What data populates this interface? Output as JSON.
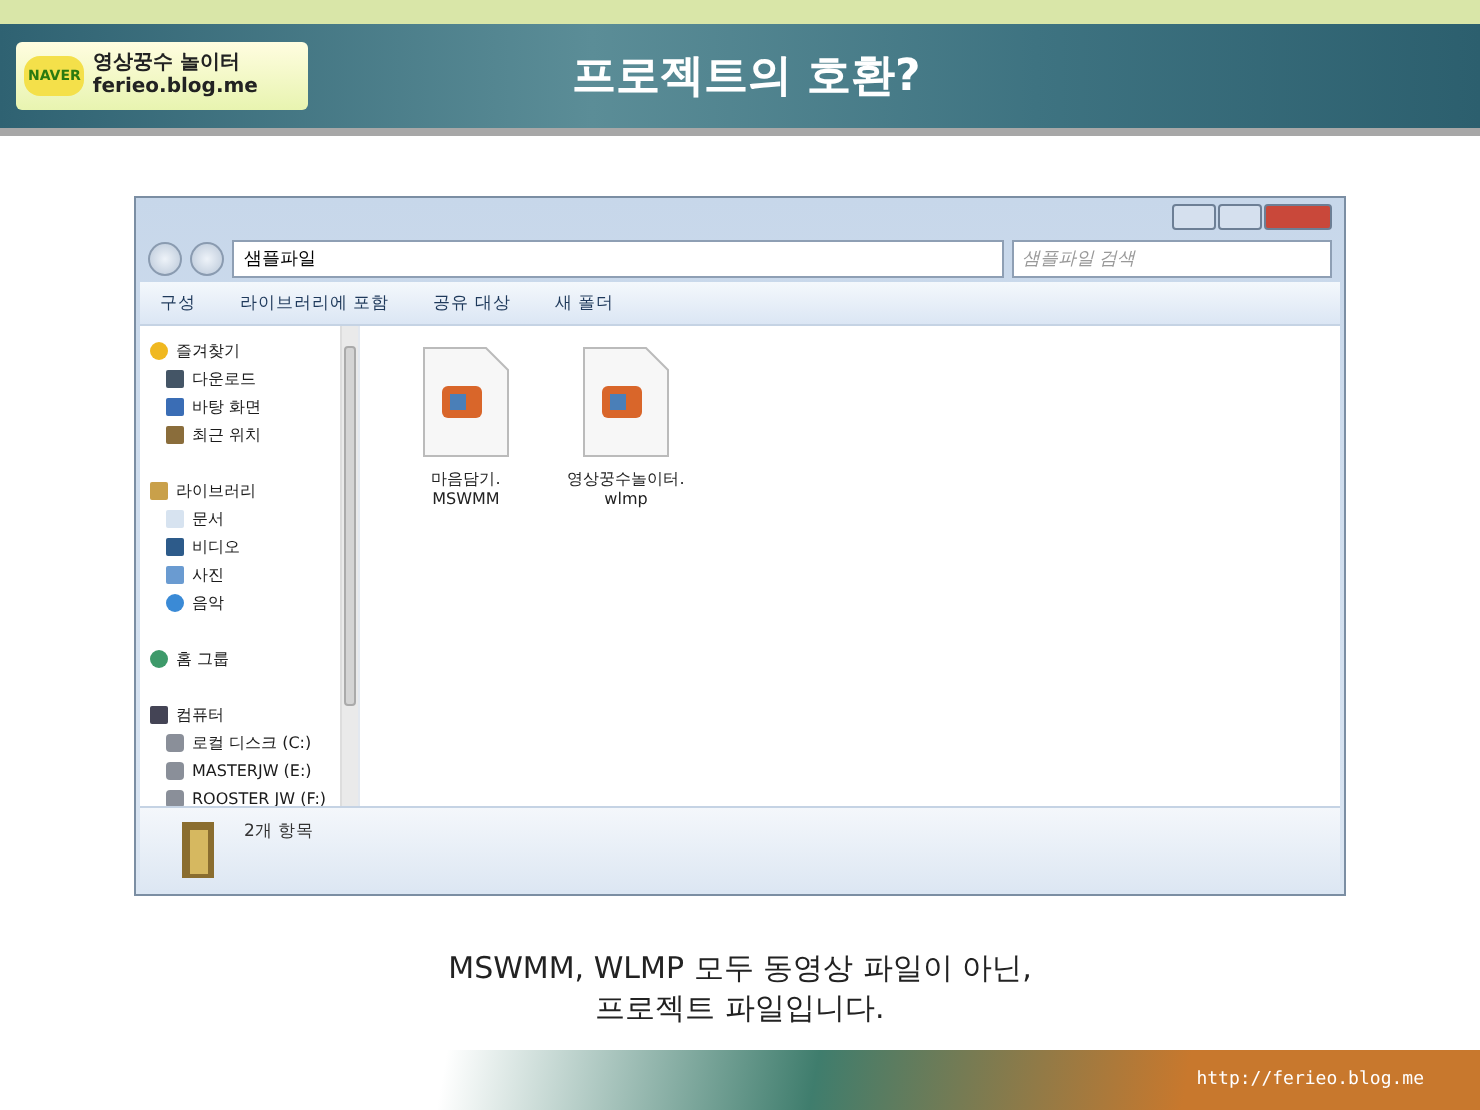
{
  "slide": {
    "logo": {
      "badge": "NAVER",
      "line_1": "영상꿍수 놀이터",
      "line_2": "ferieo.blog.me"
    },
    "title": "프로젝트의 호환?",
    "caption": [
      "MSWMM, WLMP 모두 동영상 파일이 아닌,",
      "프로젝트 파일입니다."
    ],
    "footer_url": "http://ferieo.blog.me"
  },
  "window": {
    "address": {
      "path": "샘플파일"
    },
    "search": {
      "placeholder": "샘플파일 검색"
    },
    "toolbar": [
      "구성",
      "라이브러리에 포함",
      "공유 대상",
      "새 폴더"
    ],
    "sidebar": {
      "groups": [
        {
          "label": "즐겨찾기",
          "children": [
            {
              "label": "다운로드"
            },
            {
              "label": "바탕 화면"
            },
            {
              "label": "최근 위치"
            }
          ]
        },
        {
          "label": "라이브러리",
          "children": [
            {
              "label": "문서"
            },
            {
              "label": "비디오"
            },
            {
              "label": "사진"
            },
            {
              "label": "음악"
            }
          ]
        },
        {
          "label": "홈 그룹"
        },
        {
          "label": "컴퓨터",
          "children": [
            {
              "label": "로컬 디스크 (C:)"
            },
            {
              "label": "MASTERJW (E:)"
            },
            {
              "label": "ROOSTER JW (F:)"
            }
          ]
        }
      ]
    },
    "files": [
      {
        "name": [
          "마음담기.",
          "MSWMM"
        ]
      },
      {
        "name": [
          "영상꿍수놀이터.",
          "wlmp"
        ]
      }
    ],
    "status_bar": {
      "count": "2개 항목"
    }
  }
}
